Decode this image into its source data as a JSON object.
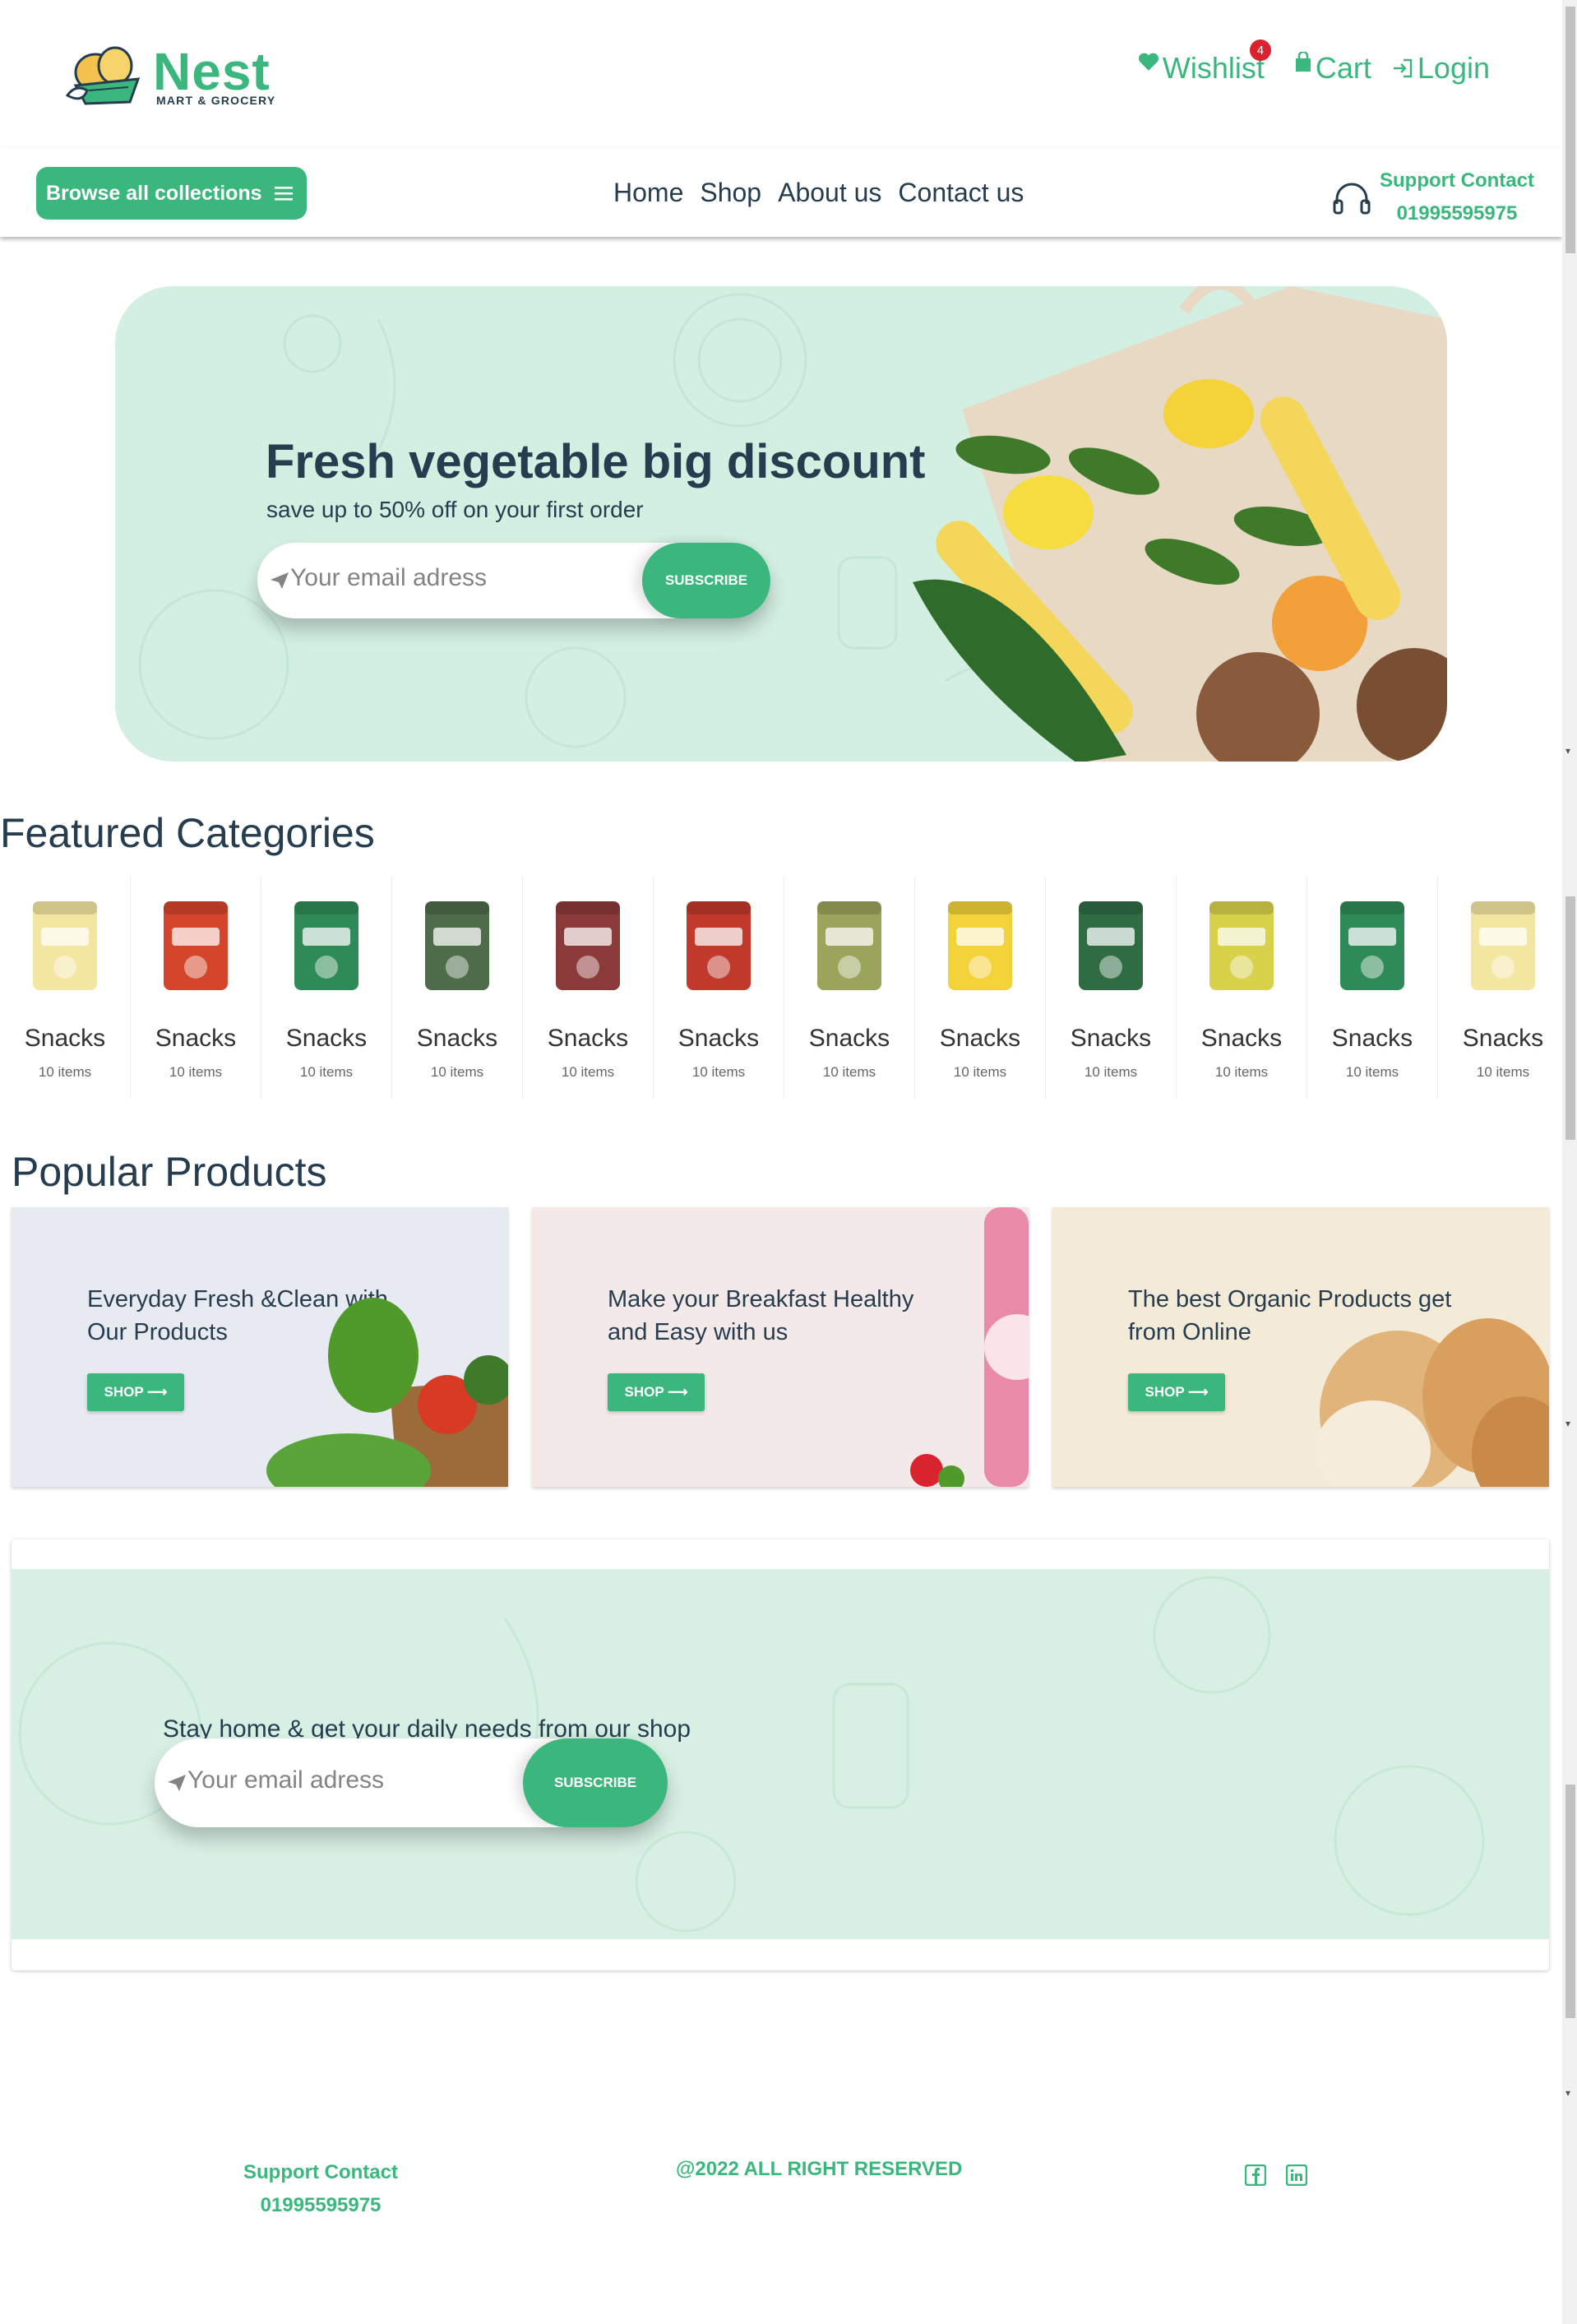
{
  "header": {
    "logo_name": "Nest",
    "logo_tagline": "MART & GROCERY",
    "wishlist_label": "Wishlist",
    "wishlist_count": "4",
    "cart_label": "Cart",
    "login_label": "Login"
  },
  "nav": {
    "browse_label": "Browse all collections",
    "links": [
      "Home",
      "Shop",
      "About us",
      "Contact us"
    ],
    "support_title": "Support Contact",
    "support_phone": "01995595975"
  },
  "hero": {
    "title": "Fresh vegetable big discount",
    "subtitle": "save up to 50% off on your first order",
    "email_placeholder": "Your email adress",
    "subscribe_label": "SUBSCRIBE"
  },
  "featured": {
    "title": "Featured Categories",
    "items": [
      {
        "name": "Snacks",
        "count": "10 items",
        "color": "#f2e6a0"
      },
      {
        "name": "Snacks",
        "count": "10 items",
        "color": "#d4452b"
      },
      {
        "name": "Snacks",
        "count": "10 items",
        "color": "#2e8b57"
      },
      {
        "name": "Snacks",
        "count": "10 items",
        "color": "#4e6b4a"
      },
      {
        "name": "Snacks",
        "count": "10 items",
        "color": "#8b3a3a"
      },
      {
        "name": "Snacks",
        "count": "10 items",
        "color": "#c0392b"
      },
      {
        "name": "Snacks",
        "count": "10 items",
        "color": "#9aa45a"
      },
      {
        "name": "Snacks",
        "count": "10 items",
        "color": "#f3d23a"
      },
      {
        "name": "Snacks",
        "count": "10 items",
        "color": "#2f6b43"
      },
      {
        "name": "Snacks",
        "count": "10 items",
        "color": "#d7d24a"
      },
      {
        "name": "Snacks",
        "count": "10 items",
        "color": "#2e8b57"
      },
      {
        "name": "Snacks",
        "count": "10 items",
        "color": "#f2e6a0"
      }
    ]
  },
  "popular": {
    "title": "Popular Products",
    "banners": [
      {
        "text": "Everyday Fresh &Clean with Our Products",
        "button": "SHOP",
        "bg": "#e8eaf2"
      },
      {
        "text": "Make your Breakfast Healthy and Easy with us",
        "button": "SHOP",
        "bg": "#f4e9e9"
      },
      {
        "text": "The best Organic Products get from Online",
        "button": "SHOP",
        "bg": "#f3ead8"
      }
    ]
  },
  "newsletter": {
    "text": "Stay home & get your daily needs from our shop",
    "email_placeholder": "Your email adress",
    "subscribe_label": "SUBSCRIBE"
  },
  "footer": {
    "support_title": "Support Contact",
    "support_phone": "01995595975",
    "rights": "@2022 ALL RIGHT RESERVED",
    "social": [
      "facebook-icon",
      "linkedin-icon"
    ]
  },
  "colors": {
    "brand": "#3bb77e",
    "heading": "#253d4e",
    "hero_bg": "#d3efe2",
    "badge": "#d9232e"
  }
}
